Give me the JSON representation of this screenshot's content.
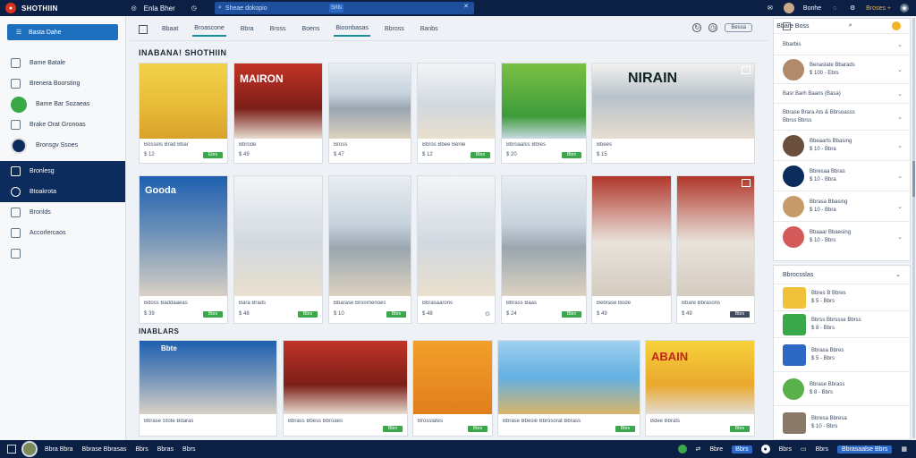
{
  "topbar": {
    "app_title": "SHOTHIIN",
    "nav_label": "Enla  Bher",
    "search_placeholder": "Sheae dokopio",
    "search_button": "Srtls",
    "user_name": "Bonhe",
    "action_label": "Broses +"
  },
  "sidebar": {
    "primary_button": "Basta Dahe",
    "items": [
      {
        "label": "Bame Batale"
      },
      {
        "label": "Brenera Boorsting"
      },
      {
        "label": "Bame Bar Sozaeas"
      },
      {
        "label": "Brake Orat Gronoas"
      },
      {
        "label": "Bronsgv Ssoes"
      },
      {
        "label": "Bronlesg"
      },
      {
        "label": "Btoakrota"
      },
      {
        "label": "Bronlds"
      },
      {
        "label": "Accorlercaos"
      }
    ]
  },
  "toolbar": {
    "tabs": [
      "Bbaat",
      "Broascone",
      "Bbra",
      "Bross",
      "Boens",
      "Bioonbasas",
      "Bbross",
      "Banbs"
    ],
    "pill": "Bessa"
  },
  "sections": {
    "featured_title": "INABANA! SHOTHIIN",
    "recent_title": "INABLARS"
  },
  "cards_row1": [
    {
      "l1": "Bossels Brad Bbar",
      "l2": "$ 12",
      "tag": "Ebrs",
      "overlay": ""
    },
    {
      "l1": "Bbrode",
      "l2": "$ 49",
      "tag": "",
      "overlay": "MAIRON"
    },
    {
      "l1": "Bross",
      "l2": "$ 47",
      "tag": "",
      "overlay": ""
    },
    {
      "l1": "Bbros Bbee Benle",
      "l2": "$ 12",
      "tag": "Bbrs",
      "overlay": ""
    },
    {
      "l1": "Bbroaalss Bbres",
      "l2": "$ 20",
      "tag": "Bbrs",
      "overlay": ""
    },
    {
      "l1": "Bbees",
      "l2": "$ 15",
      "tag": "",
      "overlay": "NIRAIN"
    }
  ],
  "cards_row2": [
    {
      "l1": "Bdoss Baddaaeas",
      "l2": "$ 39",
      "tag": "Bbrs",
      "overlay": "Gooda"
    },
    {
      "l1": "Bara Brads",
      "l2": "$ 48",
      "tag": "Bbrs",
      "overlay": ""
    },
    {
      "l1": "Bbarase Broornenoes",
      "l2": "$ 10",
      "tag": "Bbrs",
      "overlay": ""
    },
    {
      "l1": "Bbrasaarons",
      "l2": "$ 48",
      "tag": "",
      "overlay": ""
    },
    {
      "l1": "Bbrass Baas",
      "l2": "$ 24",
      "tag": "Bbrs",
      "overlay": ""
    },
    {
      "l1": "Bebrase Bode",
      "l2": "$ 49",
      "tag": "",
      "overlay": ""
    },
    {
      "l1": "Bbare Bbrasons",
      "l2": "$ 49",
      "tag": "Bbrs",
      "overlay": "",
      "dark_tag": true
    }
  ],
  "cards_row3": [
    {
      "l1": "Bbrase Stote Bdaras",
      "l2": "",
      "tag": "",
      "overlay": "Bbte"
    },
    {
      "l1": "Bbrass Bbess Bbroaes",
      "l2": "",
      "tag": "Bbrs",
      "overlay": ""
    },
    {
      "l1": "Brosslates",
      "l2": "",
      "tag": "Bbrs",
      "overlay": ""
    },
    {
      "l1": "Bbrase Bbesle Bbrosorat Bbrass",
      "l2": "",
      "tag": "Bbrs",
      "overlay": ""
    },
    {
      "l1": "Bdee Bbrats",
      "l2": "",
      "tag": "Bbrs",
      "overlay": "ABAIN"
    }
  ],
  "right_panel": {
    "top_header": "Bbare Boss",
    "top_section": "Bbarbis",
    "top_items": [
      {
        "title": "Benaslate Bbarads",
        "sub": "$ 100 - Ebrs",
        "chev": "⌄"
      },
      {
        "title": "Basr Barh Baans (Basa)",
        "sub": "",
        "chev": "⌄"
      },
      {
        "title": "Bbrase Brara Ats & Bbrsoasss",
        "sub": "Bbrss Bbrss",
        "chev": "⌄"
      },
      {
        "title": "Bbeaarts Bbasing",
        "sub": "$ 10 - Bbra",
        "chev": "⌄"
      },
      {
        "title": "Bbresaa Bbras",
        "sub": "$ 10 - Bbra",
        "chev": "⌄"
      },
      {
        "title": "Bbrasa Bbasing",
        "sub": "$ 10 - Bbra",
        "chev": "⌄"
      },
      {
        "title": "Bbaaar Bbaesing",
        "sub": "$ 10 - Bbrs",
        "chev": "⌄"
      }
    ],
    "bottom_section": "Bbrocsslas",
    "bottom_items": [
      {
        "title": "Bbres B Bbres",
        "sub": "$ 5 - Bbrs"
      },
      {
        "title": "Bbrss Bbrssse Bbrss",
        "sub": "$ 8 - Bbrs"
      },
      {
        "title": "Bbrasa Bbres",
        "sub": "$ 5 - Bbrs"
      },
      {
        "title": "Bbrase Bbrass",
        "sub": "$ 8 - Bbrs"
      },
      {
        "title": "Bbresa Bbresa",
        "sub": "$ 10 - Bbrs"
      }
    ]
  },
  "bottombar": {
    "items": [
      "Bbra Bbra",
      "Bbrase Bbrasas",
      "Bbrs",
      "Bbras",
      "Bbrs"
    ],
    "right_items": [
      "Bbre",
      "Bbrs",
      "Bbrs",
      "Bbrs"
    ],
    "tag": "Bbrasaalse Bbrs"
  }
}
